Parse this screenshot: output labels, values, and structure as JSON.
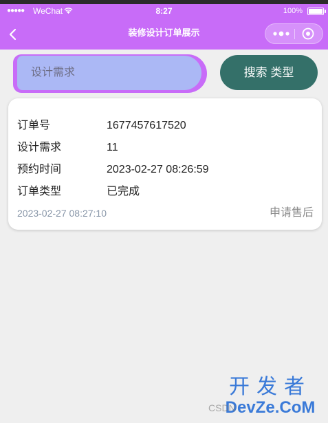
{
  "status_bar": {
    "signal": "●●●●●",
    "carrier": "WeChat",
    "time": "8:27",
    "battery": "100%"
  },
  "nav": {
    "title": "装修设计订单展示"
  },
  "search": {
    "placeholder": "设计需求",
    "button_label": "搜索  类型"
  },
  "order": {
    "rows": [
      {
        "label": "订单号",
        "value": "1677457617520"
      },
      {
        "label": "设计需求",
        "value": "11"
      },
      {
        "label": "预约时间",
        "value": "2023-02-27 08:26:59"
      },
      {
        "label": "订单类型",
        "value": "已完成"
      }
    ],
    "created_time": "2023-02-27 08:27:10",
    "action_label": "申请售后"
  },
  "watermark": {
    "line1": "开发者",
    "line2": "DevZe.CoM",
    "csdn": "CSDN"
  },
  "colors": {
    "nav_bg": "#c86cf8",
    "search_input_bg": "#abb8f5",
    "search_button_bg": "#347069",
    "page_bg": "#efefef"
  },
  "icons": [
    "back-arrow-icon",
    "more-dots-icon",
    "close-target-icon",
    "wifi-icon"
  ]
}
